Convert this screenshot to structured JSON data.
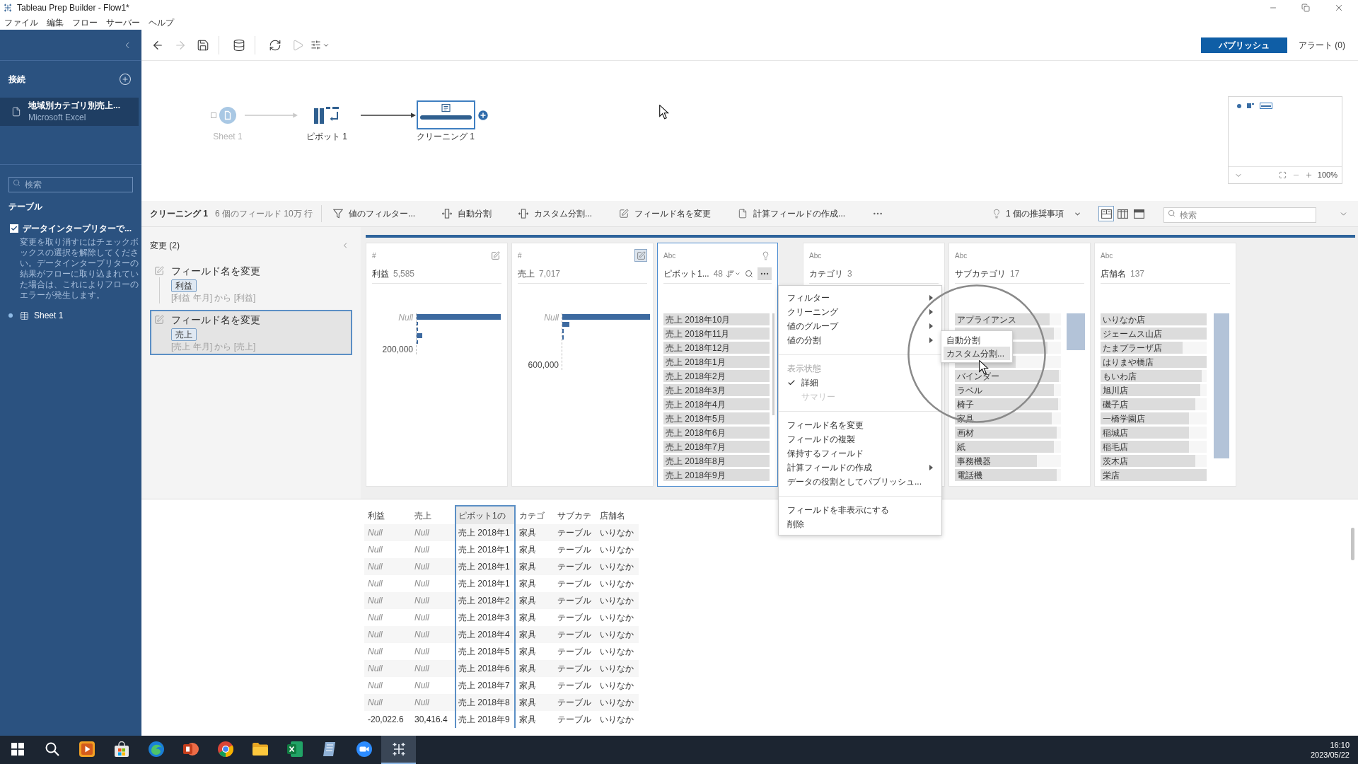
{
  "window": {
    "title": "Tableau Prep Builder - Flow1*"
  },
  "menu": [
    "ファイル",
    "編集",
    "フロー",
    "サーバー",
    "ヘルプ"
  ],
  "toolbar": {
    "tools": [
      {
        "kind": "back",
        "disabled": false
      },
      {
        "kind": "forward",
        "disabled": true
      },
      {
        "kind": "save",
        "disabled": false
      },
      {
        "kind": "separator"
      },
      {
        "kind": "data",
        "disabled": false
      },
      {
        "kind": "separator"
      },
      {
        "kind": "refresh",
        "disabled": false
      },
      {
        "kind": "run",
        "disabled": true
      },
      {
        "kind": "options",
        "disabled": false
      }
    ],
    "publish": "パブリッシュ",
    "alerts": "アラート (0)"
  },
  "sidebar": {
    "connections_title": "接続",
    "connections": [
      {
        "name": "地域別カテゴリ別売上...",
        "type": "Microsoft Excel",
        "selected": true
      }
    ],
    "search": {
      "placeholder": "検索"
    },
    "tables_title": "テーブル",
    "interpreter": {
      "label": "データインタープリターで...",
      "checked": true,
      "description": "変更を取り消すにはチェックボックスの選択を解除してください。データインタープリターの結果がフローに取り込まれていた場合は、これによりフローのエラーが発生します。"
    },
    "tables": [
      {
        "name": "Sheet 1"
      }
    ]
  },
  "flow": {
    "nodes": [
      {
        "kind": "input",
        "label": "Sheet 1",
        "selected": false,
        "dimmed": true
      },
      {
        "kind": "pivot",
        "label": "ピボット 1",
        "selected": false,
        "dimmed": false
      },
      {
        "kind": "clean",
        "label": "クリーニング 1",
        "selected": true,
        "dimmed": false
      }
    ],
    "zoom": "100%"
  },
  "step": {
    "title": "クリーニング 1",
    "summary": "6 個のフィールド 10万 行",
    "actions": [
      {
        "kind": "filter",
        "label": "値のフィルター..."
      },
      {
        "kind": "auto-split",
        "label": "自動分割"
      },
      {
        "kind": "custom-split",
        "label": "カスタム分割..."
      },
      {
        "kind": "rename",
        "label": "フィールド名を変更"
      },
      {
        "kind": "calc",
        "label": "計算フィールドの作成..."
      }
    ],
    "recommendations": "1 個の推奨事項",
    "views": [
      {
        "kind": "profile",
        "selected": true
      },
      {
        "kind": "list",
        "selected": false
      },
      {
        "kind": "grid",
        "selected": false
      }
    ],
    "search": {
      "placeholder": "検索"
    }
  },
  "changes": {
    "title": "変更 (2)",
    "items": [
      {
        "action": "フィールド名を変更",
        "field": "利益",
        "detail": "[利益 年月] から [利益]",
        "selected": false
      },
      {
        "action": "フィールド名を変更",
        "field": "売上",
        "detail": "[売上 年月] から [売上]",
        "selected": true
      }
    ]
  },
  "profile": {
    "cards": [
      {
        "kind": "histogram",
        "type": "#",
        "name": "利益",
        "count": "5,585",
        "selected": false,
        "marker": {
          "kind": "edit",
          "highlighted": false
        },
        "axis_labels": [
          "Null",
          "200,000"
        ]
      },
      {
        "kind": "histogram",
        "type": "#",
        "name": "売上",
        "count": "7,017",
        "selected": false,
        "marker": {
          "kind": "edit",
          "highlighted": true
        },
        "axis_labels": [
          "Null",
          "600,000"
        ]
      },
      {
        "kind": "list",
        "type": "Abc",
        "name": "ピボット1...",
        "count": "48",
        "selected": true,
        "marker": {
          "kind": "bulb",
          "highlighted": false
        },
        "values": [
          {
            "label": "売上 2018年10月",
            "level": 1
          },
          {
            "label": "売上 2018年11月",
            "level": 1
          },
          {
            "label": "売上 2018年12月",
            "level": 1
          },
          {
            "label": "売上 2018年1月",
            "level": 1
          },
          {
            "label": "売上 2018年2月",
            "level": 1
          },
          {
            "label": "売上 2018年3月",
            "level": 1
          },
          {
            "label": "売上 2018年4月",
            "level": 1
          },
          {
            "label": "売上 2018年5月",
            "level": 1
          },
          {
            "label": "売上 2018年6月",
            "level": 1
          },
          {
            "label": "売上 2018年7月",
            "level": 1
          },
          {
            "label": "売上 2018年8月",
            "level": 1
          },
          {
            "label": "売上 2018年9月",
            "level": 1
          }
        ]
      },
      {
        "kind": "list",
        "type": "Abc",
        "name": "カテゴリ",
        "count": "3",
        "selected": false
      },
      {
        "kind": "list",
        "type": "Abc",
        "name": "サブカテゴリ",
        "count": "17",
        "selected": false,
        "values": [
          {
            "label": "アプライアンス",
            "level": 0.89
          },
          {
            "level": 0.93
          },
          {
            "level": 0.87
          },
          {
            "level": 0.57
          },
          {
            "label": "バインダー",
            "level": 0.98
          },
          {
            "label": "ラベル",
            "level": 0.93
          },
          {
            "label": "椅子",
            "level": 0.97
          },
          {
            "label": "家具",
            "level": 0.91
          },
          {
            "label": "画材",
            "level": 0.96
          },
          {
            "label": "紙",
            "level": 0.93
          },
          {
            "label": "事務機器",
            "level": 0.77
          },
          {
            "label": "電話機",
            "level": 0.96
          }
        ]
      },
      {
        "kind": "list",
        "type": "Abc",
        "name": "店舗名",
        "count": "137",
        "selected": false,
        "values": [
          {
            "label": "いりなか店",
            "level": 1
          },
          {
            "label": "ジェームス山店",
            "level": 1
          },
          {
            "label": "たまプラーザ店",
            "level": 0.77
          },
          {
            "label": "はりまや橋店",
            "level": 1
          },
          {
            "label": "もいわ店",
            "level": 0.95
          },
          {
            "label": "旭川店",
            "level": 0.94
          },
          {
            "label": "磯子店",
            "level": 0.89
          },
          {
            "label": "一橋学園店",
            "level": 0.83
          },
          {
            "label": "稲城店",
            "level": 0.83
          },
          {
            "label": "稲毛店",
            "level": 0.83
          },
          {
            "label": "茨木店",
            "level": 0.89
          },
          {
            "label": "栄店",
            "level": 1
          }
        ]
      }
    ]
  },
  "context_menu": {
    "sections": [
      {
        "items": [
          {
            "label": "フィルター",
            "submenu": true
          },
          {
            "label": "クリーニング",
            "submenu": true
          },
          {
            "label": "値のグループ",
            "submenu": true
          },
          {
            "label": "値の分割",
            "submenu": true
          }
        ]
      },
      {
        "header": "表示状態",
        "options": [
          {
            "label": "詳細",
            "checked": true,
            "disabled": false
          },
          {
            "label": "サマリー",
            "checked": false,
            "disabled": true
          }
        ]
      },
      {
        "items": [
          {
            "label": "フィールド名を変更",
            "submenu": false
          },
          {
            "label": "フィールドの複製",
            "submenu": false
          },
          {
            "label": "保持するフィールド",
            "submenu": false
          },
          {
            "label": "計算フィールドの作成",
            "submenu": true
          },
          {
            "label": "データの役割としてパブリッシュ...",
            "submenu": false
          }
        ]
      },
      {
        "items": [
          {
            "label": "フィールドを非表示にする",
            "submenu": false
          },
          {
            "label": "削除",
            "submenu": false
          }
        ]
      }
    ]
  },
  "submenu": {
    "items": [
      {
        "label": "自動分割",
        "selected": false
      },
      {
        "label": "カスタム分割...",
        "selected": true
      }
    ]
  },
  "grid": {
    "columns": [
      {
        "label": "利益",
        "selected": false
      },
      {
        "label": "売上",
        "selected": false
      },
      {
        "label": "ピボット1の",
        "selected": true
      },
      {
        "label": "カテゴ",
        "selected": false
      },
      {
        "label": "サブカテ",
        "selected": false
      },
      {
        "label": "店舗名",
        "selected": false
      }
    ],
    "rows": [
      {
        "cells": [
          {
            "null": "Null"
          },
          {
            "null": "Null"
          },
          "売上 2018年1",
          "家具",
          "テーブル",
          "いりなか"
        ]
      },
      {
        "cells": [
          {
            "null": "Null"
          },
          {
            "null": "Null"
          },
          "売上 2018年1",
          "家具",
          "テーブル",
          "いりなか"
        ]
      },
      {
        "cells": [
          {
            "null": "Null"
          },
          {
            "null": "Null"
          },
          "売上 2018年1",
          "家具",
          "テーブル",
          "いりなか"
        ]
      },
      {
        "cells": [
          {
            "null": "Null"
          },
          {
            "null": "Null"
          },
          "売上 2018年1",
          "家具",
          "テーブル",
          "いりなか"
        ]
      },
      {
        "cells": [
          {
            "null": "Null"
          },
          {
            "null": "Null"
          },
          "売上 2018年2",
          "家具",
          "テーブル",
          "いりなか"
        ]
      },
      {
        "cells": [
          {
            "null": "Null"
          },
          {
            "null": "Null"
          },
          "売上 2018年3",
          "家具",
          "テーブル",
          "いりなか"
        ]
      },
      {
        "cells": [
          {
            "null": "Null"
          },
          {
            "null": "Null"
          },
          "売上 2018年4",
          "家具",
          "テーブル",
          "いりなか"
        ]
      },
      {
        "cells": [
          {
            "null": "Null"
          },
          {
            "null": "Null"
          },
          "売上 2018年5",
          "家具",
          "テーブル",
          "いりなか"
        ]
      },
      {
        "cells": [
          {
            "null": "Null"
          },
          {
            "null": "Null"
          },
          "売上 2018年6",
          "家具",
          "テーブル",
          "いりなか"
        ]
      },
      {
        "cells": [
          {
            "null": "Null"
          },
          {
            "null": "Null"
          },
          "売上 2018年7",
          "家具",
          "テーブル",
          "いりなか"
        ]
      },
      {
        "cells": [
          {
            "null": "Null"
          },
          {
            "null": "Null"
          },
          "売上 2018年8",
          "家具",
          "テーブル",
          "いりなか"
        ]
      },
      {
        "cells": [
          "-20,022.6",
          "30,416.4",
          "売上 2018年9",
          "家具",
          "テーブル",
          "いりなか"
        ]
      }
    ]
  },
  "taskbar": {
    "apps": [
      {
        "kind": "start",
        "selected": false
      },
      {
        "kind": "search",
        "selected": false
      },
      {
        "kind": "media",
        "selected": false
      },
      {
        "kind": "store",
        "selected": false
      },
      {
        "kind": "browser",
        "selected": false
      },
      {
        "kind": "presentation",
        "selected": false
      },
      {
        "kind": "web",
        "selected": false
      },
      {
        "kind": "folder",
        "selected": false
      },
      {
        "kind": "spreadsheet",
        "selected": false
      },
      {
        "kind": "notes",
        "selected": false
      },
      {
        "kind": "meeting",
        "selected": false
      },
      {
        "kind": "prep",
        "selected": true
      }
    ],
    "time": "16:10",
    "date": "2023/05/22"
  }
}
